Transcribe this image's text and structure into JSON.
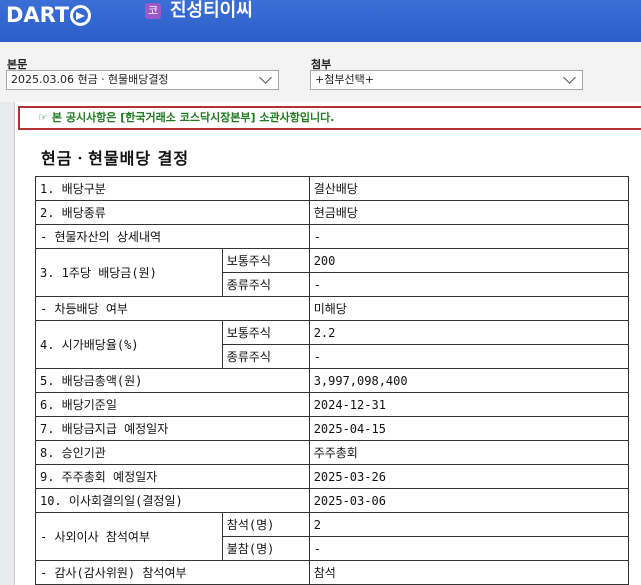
{
  "header": {
    "logo_text": "DART",
    "badge": "코",
    "company_name": "진성티이씨"
  },
  "selectors": {
    "body_label": "본문",
    "body_value": "2025.03.06  현금ㆍ현물배당결정",
    "attach_label": "첨부",
    "attach_value": "+첨부선택+"
  },
  "notice": {
    "icon": "☞",
    "text": "본 공시사항은 [한국거래소 코스닥시장본부] 소관사항입니다."
  },
  "document": {
    "title": "현금ㆍ현물배당 결정",
    "rows": {
      "r1": {
        "label": "1. 배당구분",
        "value": "결산배당"
      },
      "r2": {
        "label": "2. 배당종류",
        "value": "현금배당"
      },
      "r3": {
        "label": "- 현물자산의 상세내역",
        "value": "-"
      },
      "r4": {
        "label": "3. 1주당 배당금(원)",
        "sub1": "보통주식",
        "val1": "200",
        "sub2": "종류주식",
        "val2": "-"
      },
      "r5": {
        "label": "- 차등배당 여부",
        "value": "미해당"
      },
      "r6": {
        "label": "4. 시가배당율(%)",
        "sub1": "보통주식",
        "val1": "2.2",
        "sub2": "종류주식",
        "val2": "-"
      },
      "r7": {
        "label": "5. 배당금총액(원)",
        "value": "3,997,098,400"
      },
      "r8": {
        "label": "6. 배당기준일",
        "value": "2024-12-31"
      },
      "r9": {
        "label": "7. 배당금지급 예정일자",
        "value": "2025-04-15"
      },
      "r10": {
        "label": "8. 승인기관",
        "value": "주주총회"
      },
      "r11": {
        "label": "9. 주주총회 예정일자",
        "value": "2025-03-26"
      },
      "r12": {
        "label": "10. 이사회결의일(결정일)",
        "value": "2025-03-06"
      },
      "r13": {
        "label": "- 사외이사 참석여부",
        "sub1": "참석(명)",
        "val1": "2",
        "sub2": "불참(명)",
        "val2": "-"
      },
      "r14": {
        "label": "- 감사(감사위원) 참석여부",
        "value": "참석"
      }
    }
  }
}
